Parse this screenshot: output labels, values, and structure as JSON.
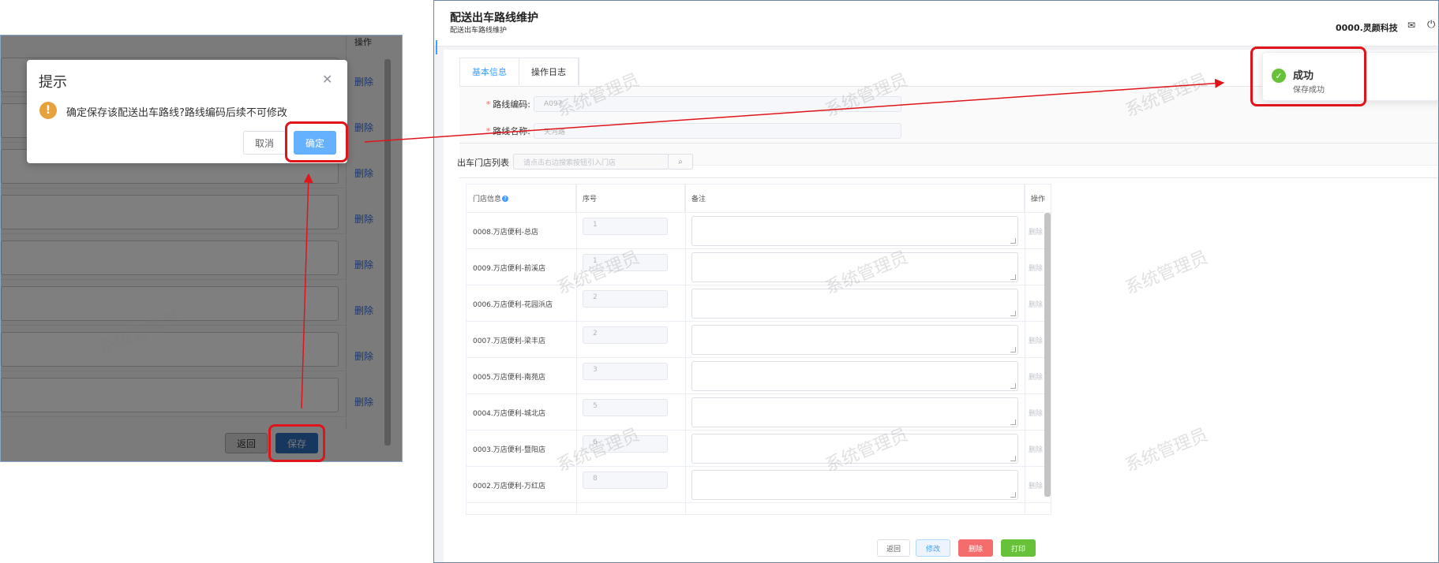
{
  "watermark_text": "系统管理员",
  "left_panel": {
    "ops_header": "操作",
    "delete_label": "删除",
    "back_label": "返回",
    "save_label": "保存",
    "dialog": {
      "title": "提示",
      "message": "确定保存该配送出车路线?路线编码后续不可修改",
      "cancel": "取消",
      "confirm": "确定"
    }
  },
  "right_panel": {
    "header": {
      "title": "配送出车路线维护",
      "subtitle": "配送出车路线维护",
      "company": "0000.灵颜科技"
    },
    "tabs": [
      {
        "label": "基本信息"
      },
      {
        "label": "操作日志"
      }
    ],
    "form": {
      "route_code_label": "路线编码:",
      "route_code_value": "A097",
      "route_name_label": "路线名称:",
      "route_name_value": "天河路"
    },
    "store_list": {
      "label": "出车门店列表",
      "search_placeholder": "请点击右边搜索按钮引入门店"
    },
    "table": {
      "headers": {
        "store": "门店信息",
        "seq": "序号",
        "note": "备注",
        "ops": "操作"
      },
      "delete_label": "删除",
      "rows": [
        {
          "store": "0008.万店便利-总店",
          "seq": "1"
        },
        {
          "store": "0009.万店便利-前溪店",
          "seq": "1"
        },
        {
          "store": "0006.万店便利-花园浜店",
          "seq": "2"
        },
        {
          "store": "0007.万店便利-梁丰店",
          "seq": "2"
        },
        {
          "store": "0005.万店便利-南苑店",
          "seq": "3"
        },
        {
          "store": "0004.万店便利-城北店",
          "seq": "5"
        },
        {
          "store": "0003.万店便利-暨阳店",
          "seq": "6"
        },
        {
          "store": "0002.万店便利-万红店",
          "seq": "8"
        }
      ]
    },
    "footer": {
      "back": "返回",
      "edit": "修改",
      "delete": "删除",
      "print": "打印"
    },
    "toast": {
      "title": "成功",
      "message": "保存成功"
    }
  },
  "colors": {
    "primary": "#409eff",
    "success": "#67c23a",
    "danger": "#f56c6c",
    "warning": "#e6a23c",
    "annotation_red": "#e0151b"
  }
}
